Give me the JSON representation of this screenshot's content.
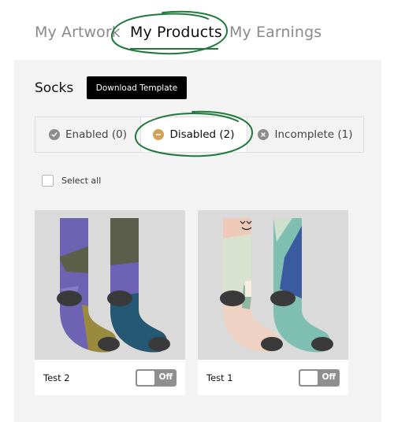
{
  "nav": {
    "artwork": "My Artwork",
    "products": "My Products",
    "earnings": "My Earnings"
  },
  "section": {
    "title": "Socks",
    "download_label": "Download Template"
  },
  "tabs": [
    {
      "label": "Enabled (0)",
      "icon": "check-circle-icon"
    },
    {
      "label": "Disabled (2)",
      "icon": "minus-circle-icon",
      "active": true
    },
    {
      "label": "Incomplete (1)",
      "icon": "x-circle-icon"
    }
  ],
  "select_all": {
    "label": "Select all",
    "checked": false
  },
  "products": [
    {
      "name": "Test 2",
      "toggle_label": "Off",
      "enabled": false
    },
    {
      "name": "Test 1",
      "toggle_label": "Off",
      "enabled": false
    }
  ],
  "colors": {
    "accent_green": "#1f7a3b",
    "disabled_orange": "#d4a257",
    "toggle_off": "#8f8f8f"
  }
}
